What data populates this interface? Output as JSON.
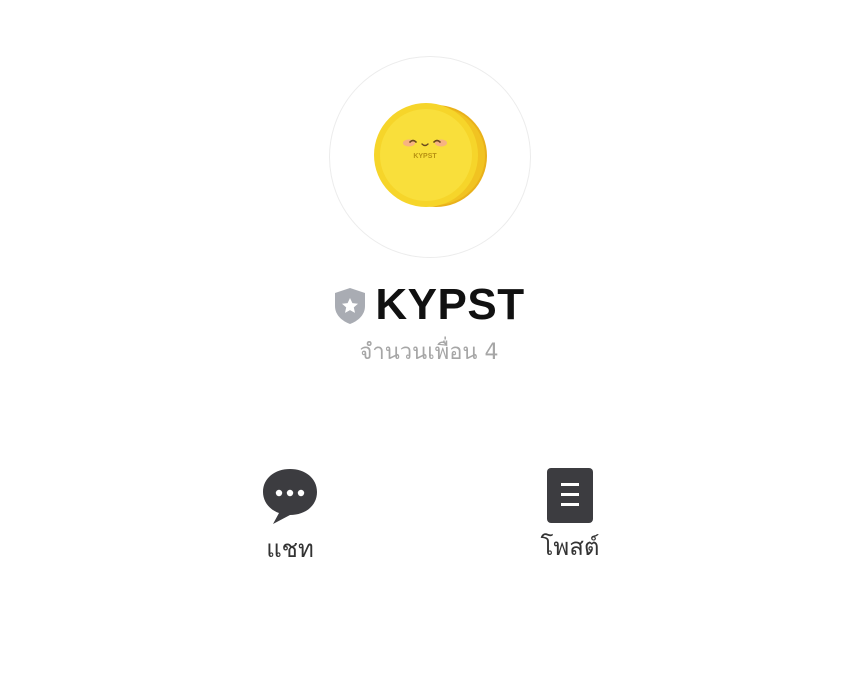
{
  "profile": {
    "account_name": "KYPST",
    "friends_count": "จำนวนเพื่อน 4",
    "avatar_text": "KYPST",
    "badge_icon": "verified-shield-star-icon"
  },
  "actions": [
    {
      "label": "แชท",
      "icon": "chat-bubble-icon"
    },
    {
      "label": "โพสต์",
      "icon": "post-document-icon"
    }
  ],
  "colors": {
    "coin_gold": "#f5d21f",
    "coin_rim": "#ebb51c",
    "icon_dark": "#3c3c40",
    "badge_gray": "#a9acb3",
    "muted_text": "#a6a6a6"
  }
}
